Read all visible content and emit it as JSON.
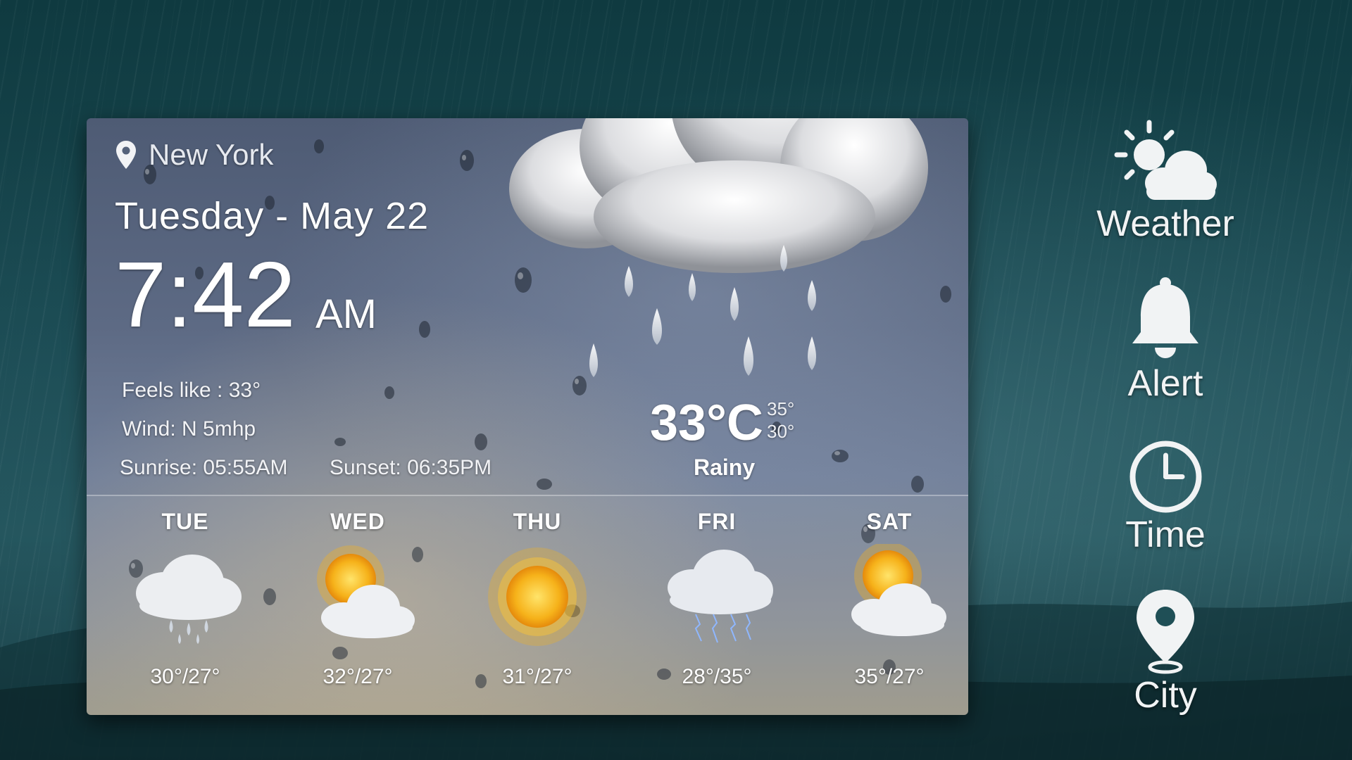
{
  "widget": {
    "location": "New York",
    "date": "Tuesday - May 22",
    "time": "7:42",
    "ampm": "AM",
    "feels_like": "Feels like : 33°",
    "wind": "Wind: N 5mhp",
    "sunrise": "Sunrise: 05:55AM",
    "sunset": "Sunset: 06:35PM",
    "current_temp": "33°C",
    "high": "35°",
    "low": "30°",
    "condition": "Rainy",
    "current_icon": "rain-cloud-icon"
  },
  "forecast": [
    {
      "day": "TUE",
      "temps": "30°/27°",
      "icon": "rain-cloud-icon"
    },
    {
      "day": "WED",
      "temps": "32°/27°",
      "icon": "partly-sunny-icon"
    },
    {
      "day": "THU",
      "temps": "31°/27°",
      "icon": "sun-icon"
    },
    {
      "day": "FRI",
      "temps": "28°/35°",
      "icon": "thunderstorm-icon"
    },
    {
      "day": "SAT",
      "temps": "35°/27°",
      "icon": "partly-sunny-icon"
    }
  ],
  "sidebar": {
    "items": [
      {
        "label": "Weather",
        "icon": "weather-icon"
      },
      {
        "label": "Alert",
        "icon": "bell-icon"
      },
      {
        "label": "Time",
        "icon": "clock-icon"
      },
      {
        "label": "City",
        "icon": "location-pin-icon"
      }
    ]
  },
  "colors": {
    "background": "#1a4a52",
    "sun": "#f6b21a",
    "text": "#ffffff"
  }
}
